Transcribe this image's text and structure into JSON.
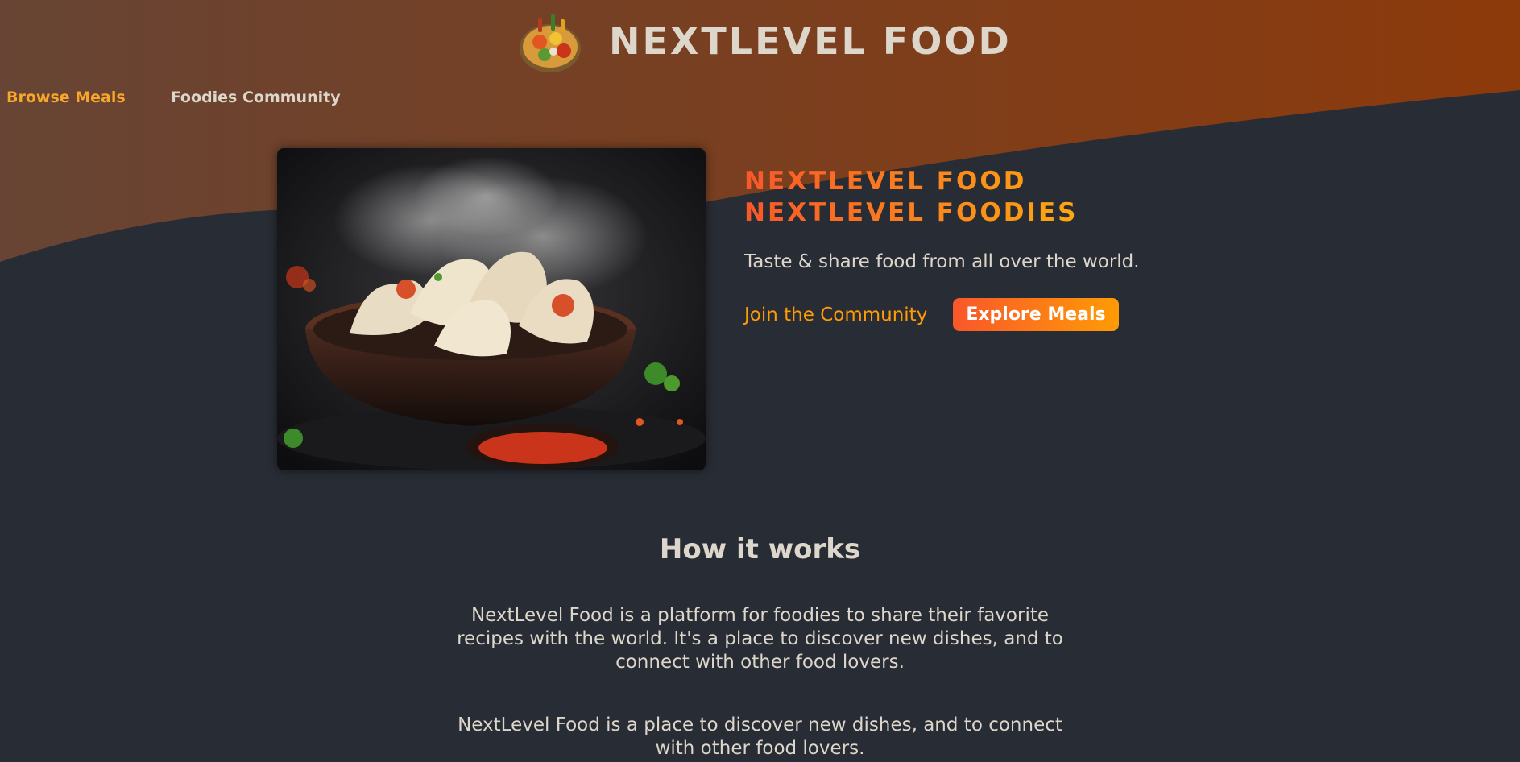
{
  "brand": {
    "name": "NextLevel Food"
  },
  "nav": {
    "items": [
      {
        "label": "Browse Meals",
        "active": true
      },
      {
        "label": "Foodies Community",
        "active": false
      }
    ]
  },
  "hero": {
    "title": "NextLevel Food NextLevel Foodies",
    "subtitle": "Taste & share food from all over the world.",
    "join_label": "Join the Community",
    "explore_label": "Explore Meals",
    "image_alt": "Steaming dumplings in a bowl"
  },
  "how_it_works": {
    "heading": "How it works",
    "paragraphs": [
      "NextLevel Food is a platform for foodies to share their favorite recipes with the world. It's a place to discover new dishes, and to connect with other food lovers.",
      "NextLevel Food is a place to discover new dishes, and to connect with other food lovers."
    ]
  },
  "colors": {
    "background": "#282c34",
    "header_gradient_start": "#6a4a3a",
    "header_gradient_end": "#8c3a0c",
    "accent_orange": "#f9572a",
    "accent_yellow": "#ffc905",
    "nav_active": "#f9a72b",
    "text": "#ddd6cb"
  }
}
